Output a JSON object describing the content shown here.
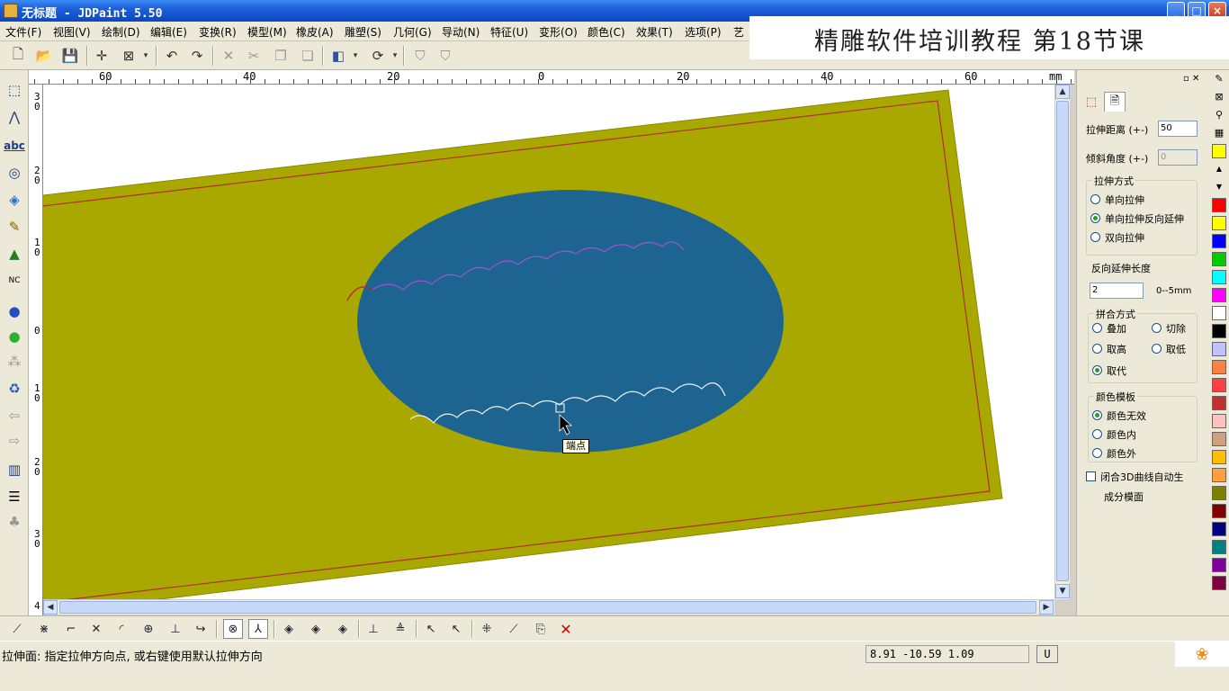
{
  "window": {
    "title": "无标题 - JDPaint 5.50",
    "controls": [
      "_",
      "□",
      "×"
    ]
  },
  "menu": [
    "文件(F)",
    "视图(V)",
    "绘制(D)",
    "编辑(E)",
    "变换(R)",
    "模型(M)",
    "橡皮(A)",
    "雕塑(S)",
    "几何(G)",
    "导动(N)",
    "特征(U)",
    "变形(O)",
    "颜色(C)",
    "效果(T)",
    "选项(P)",
    "艺"
  ],
  "caption": "精雕软件培训教程 第18节课",
  "toolbar_icons": [
    "new-file",
    "open-folder",
    "save",
    "cross-cursor",
    "select-box",
    "dropdown",
    "undo",
    "redo",
    "delete",
    "cut",
    "copy",
    "paste",
    "cube-view",
    "dropdown",
    "rotate-view",
    "dropdown",
    "shield-a",
    "shield-b"
  ],
  "ruler": {
    "unit": "mm",
    "h_labels": [
      "60",
      "40",
      "20",
      "0",
      "20",
      "40",
      "60"
    ],
    "v_labels": [
      "3\n0",
      "2\n0",
      "1\n0",
      "0",
      "1\n0",
      "2\n0",
      "3\n0",
      "4"
    ]
  },
  "tooltip": "端点",
  "panel": {
    "stretch_distance_label": "拉伸距离 (+-)",
    "stretch_distance_value": "50",
    "tilt_angle_label": "倾斜角度 (+-)",
    "tilt_angle_value": "0",
    "stretch_mode_label": "拉伸方式",
    "stretch_modes": [
      "单向拉伸",
      "单向拉伸反向延伸",
      "双向拉伸"
    ],
    "stretch_mode_selected": 1,
    "reverse_length_label": "反向延伸长度",
    "reverse_length_value": "2",
    "reverse_length_range": "0--5mm",
    "combine_mode_label": "拼合方式",
    "combine_modes": [
      "叠加",
      "切除",
      "取高",
      "取低",
      "取代"
    ],
    "combine_mode_selected": 4,
    "color_template_label": "颜色模板",
    "color_templates": [
      "颜色无效",
      "颜色内",
      "颜色外"
    ],
    "color_template_selected": 0,
    "auto_surface_label": "闭合3D曲线自动生",
    "auto_surface_label2": "成分模面",
    "auto_surface_checked": false
  },
  "palette_colors": [
    "#ffff00",
    "#ff0000",
    "#ffff00",
    "#0000ff",
    "#00cc00",
    "#00ffff",
    "#ff00ff",
    "#ffffff",
    "#000000",
    "#c0c0ff",
    "#ff8040",
    "#ff4040",
    "#c03030",
    "#ffc0c0",
    "#d0a080",
    "#ffc000",
    "#ffa040",
    "#808000",
    "#800000",
    "#000080",
    "#008080",
    "#8000a0",
    "#800040"
  ],
  "scene_colors": {
    "plate": "#a8a800",
    "plate_border": "#b03030",
    "ellipse": "#1d6590",
    "curve_top": "#a050d0",
    "curve_bottom": "#f0f0f0"
  },
  "status": {
    "message": "拉伸面: 指定拉伸方向点, 或右键使用默认拉伸方向",
    "coords": "8.91 -10.59 1.09",
    "unit": "U"
  }
}
